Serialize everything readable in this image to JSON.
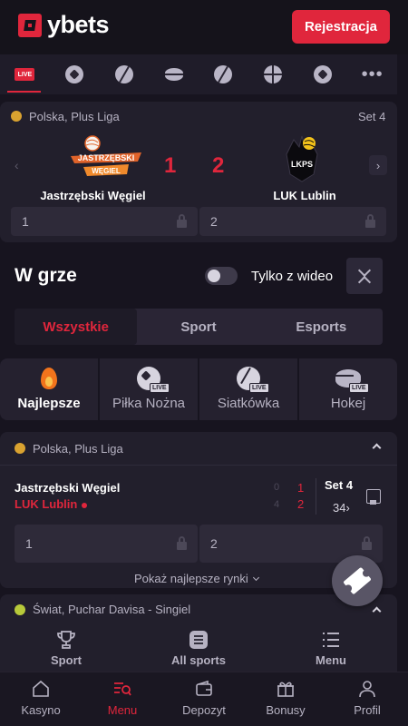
{
  "header": {
    "brand": "ybets",
    "register_label": "Rejestracja"
  },
  "sport_strip": {
    "live_badge": "LIVE",
    "items": [
      "live-icon",
      "football-icon",
      "volleyball-icon",
      "hockey-icon",
      "basketball-ball-icon",
      "basketball-icon",
      "handball-icon",
      "more-icon"
    ]
  },
  "featured": {
    "league": "Polska, Plus Liga",
    "set": "Set 4",
    "home_team": "Jastrzębski Węgiel",
    "away_team": "LUK Lublin",
    "home_logo_text": "JASTRZĘBSKI WĘGIEL",
    "away_logo_text": "LKPS",
    "home_score": "1",
    "away_score": "2",
    "odd_home": "1",
    "odd_away": "2"
  },
  "in_play": {
    "title": "W grze",
    "video_toggle_label": "Tylko z wideo",
    "video_toggle_on": false,
    "tabs": [
      "Wszystkie",
      "Sport",
      "Esports"
    ],
    "active_tab": "Wszystkie",
    "categories": [
      {
        "label": "Najlepsze",
        "icon": "flame-icon",
        "active": true
      },
      {
        "label": "Piłka Nożna",
        "icon": "football-live-icon",
        "live": "LIVE"
      },
      {
        "label": "Siatkówka",
        "icon": "volleyball-live-icon",
        "live": "LIVE"
      },
      {
        "label": "Hokej",
        "icon": "hockey-live-icon",
        "live": "LIVE"
      }
    ]
  },
  "match": {
    "league": "Polska, Plus Liga",
    "home_team": "Jastrzębski Węgiel",
    "away_team": "LUK Lublin",
    "home_prev": "0",
    "away_prev": "4",
    "home_sets": "1",
    "away_sets": "2",
    "set": "Set 4",
    "markets_count": "34",
    "odd_home": "1",
    "odd_away": "2",
    "show_best": "Pokaż najlepsze rynki"
  },
  "next_league": "Świat, Puchar Davisa - Singiel",
  "sub_nav": [
    "Sport",
    "All sports",
    "Menu"
  ],
  "bottom_nav": [
    {
      "label": "Kasyno",
      "icon": "home-icon"
    },
    {
      "label": "Menu",
      "icon": "menu-search-icon",
      "active": true
    },
    {
      "label": "Depozyt",
      "icon": "wallet-icon"
    },
    {
      "label": "Bonusy",
      "icon": "gift-icon"
    },
    {
      "label": "Profil",
      "icon": "user-icon"
    }
  ],
  "colors": {
    "accent": "#e0263c",
    "background": "#17141f",
    "card": "#221f2c"
  }
}
